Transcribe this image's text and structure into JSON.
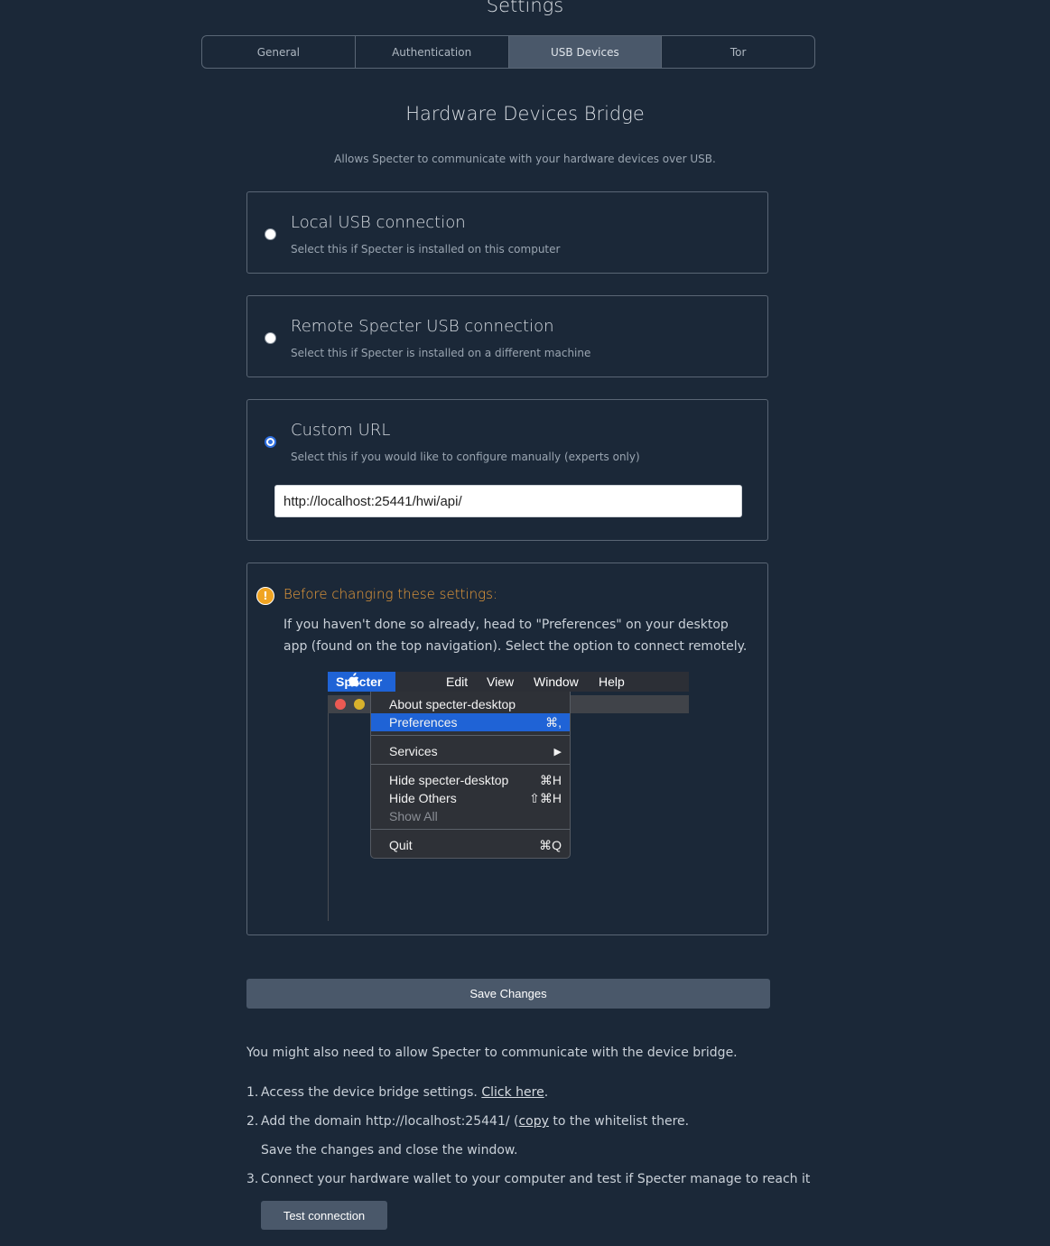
{
  "page_title": "Settings",
  "tabs": [
    {
      "label": "General",
      "active": false
    },
    {
      "label": "Authentication",
      "active": false
    },
    {
      "label": "USB Devices",
      "active": true
    },
    {
      "label": "Tor",
      "active": false
    }
  ],
  "section": {
    "title": "Hardware Devices Bridge",
    "subtitle": "Allows Specter to communicate with your hardware devices over USB."
  },
  "options": [
    {
      "title": "Local USB connection",
      "desc": "Select this if Specter is installed on this computer",
      "checked": false
    },
    {
      "title": "Remote Specter USB connection",
      "desc": "Select this if Specter is installed on a different machine",
      "checked": false
    },
    {
      "title": "Custom URL",
      "desc": "Select this if you would like to configure manually (experts only)",
      "checked": true
    }
  ],
  "custom_url": {
    "value": "http://localhost:25441/hwi/api/"
  },
  "warning": {
    "icon": "!",
    "title": "Before changing these settings:",
    "text": "If you haven't done so already, head to \"Preferences\" on your desktop app (found on the top navigation). Select the option to connect remotely.",
    "icon_color": "#f0a422"
  },
  "mac_menu": {
    "apple": "",
    "app_name": "Specter",
    "bar_items": [
      "Edit",
      "View",
      "Window",
      "Help"
    ],
    "items": {
      "about": "About specter-desktop",
      "preferences": "Preferences",
      "preferences_shortcut": "⌘,",
      "services": "Services",
      "services_arrow": "▶",
      "hide": "Hide specter-desktop",
      "hide_shortcut": "⌘H",
      "hide_others": "Hide Others",
      "hide_others_shortcut": "⇧⌘H",
      "show_all": "Show All",
      "quit": "Quit",
      "quit_shortcut": "⌘Q"
    }
  },
  "save_button": "Save Changes",
  "note": "You might also need to allow Specter to communicate with the device bridge.",
  "steps": {
    "s1": {
      "num": "1.",
      "text": "Access the device bridge settings. ",
      "link": "Click here",
      "after": "."
    },
    "s2": {
      "num": "2.",
      "text": "Add the domain http://localhost:25441/ (",
      "link": "copy",
      "after": " to the whitelist there."
    },
    "s2b": "Save the changes and close the window.",
    "s3": {
      "num": "3.",
      "text": "Connect your hardware wallet to your computer and test if Specter manage to reach it"
    }
  },
  "test_button": "Test connection",
  "colors": {
    "background": "#1b2838",
    "accent": "#4a586a",
    "warning": "#f0a03a",
    "menu_highlight": "#1f63d6"
  }
}
